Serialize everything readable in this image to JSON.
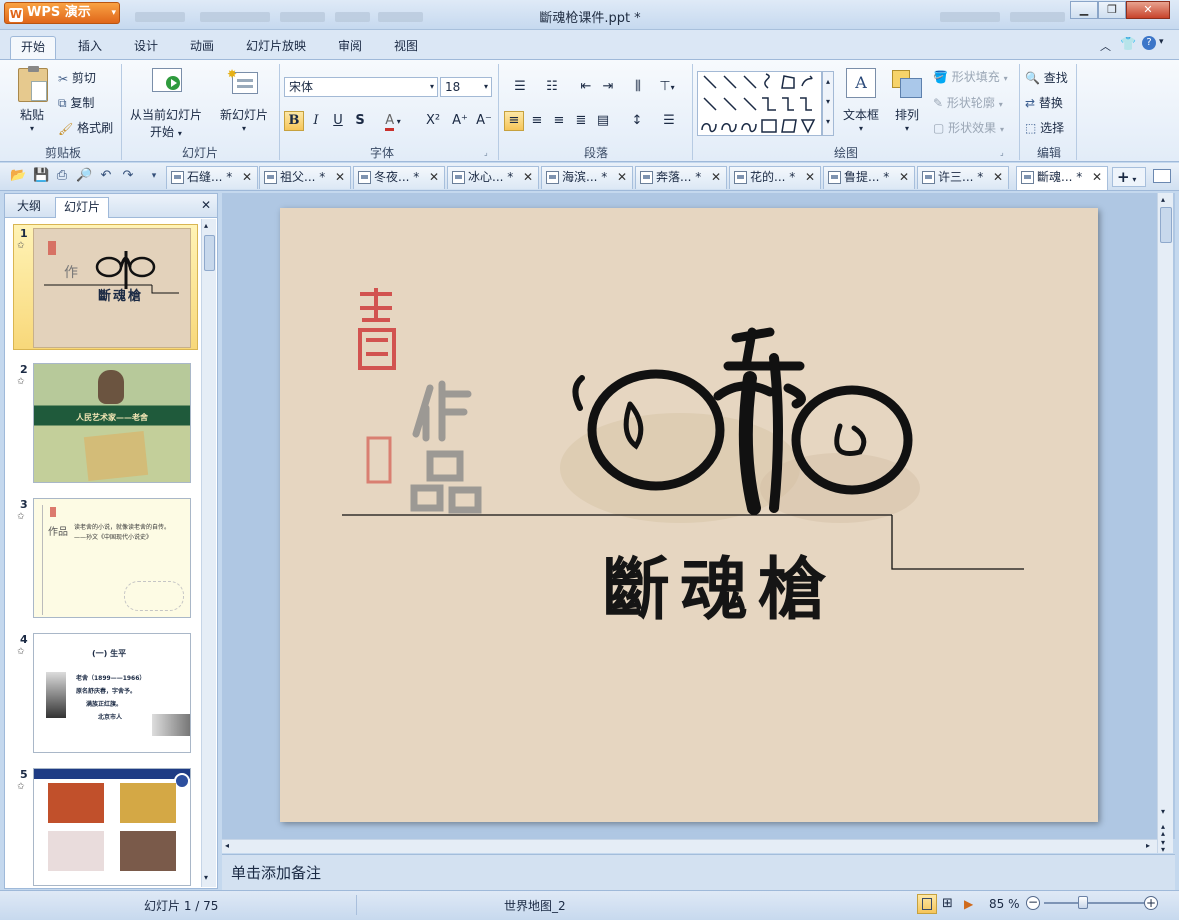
{
  "app": {
    "button_label": "WPS 演示",
    "doc_title": "斷魂枪课件.ppt *"
  },
  "menu": {
    "tabs": [
      "开始",
      "插入",
      "设计",
      "动画",
      "幻灯片放映",
      "审阅",
      "视图"
    ],
    "active": "开始"
  },
  "ribbon": {
    "clipboard": {
      "paste": "粘贴",
      "cut": "剪切",
      "copy": "复制",
      "format_painter": "格式刷",
      "group": "剪贴板"
    },
    "slides": {
      "from_current": "从当前幻灯片",
      "start": "开始",
      "new_slide": "新幻灯片",
      "group": "幻灯片"
    },
    "font": {
      "name": "宋体",
      "size": "18",
      "group": "字体",
      "bold": "B",
      "italic": "I",
      "underline": "U",
      "shadow": "S"
    },
    "paragraph": {
      "group": "段落"
    },
    "drawing": {
      "textbox": "文本框",
      "arrange": "排列",
      "fill": "形状填充",
      "outline": "形状轮廓",
      "effects": "形状效果",
      "group": "绘图"
    },
    "edit": {
      "find": "查找",
      "replace": "替换",
      "select": "选择",
      "group": "编辑"
    }
  },
  "doc_tabs": [
    "石缝... *",
    "祖父... *",
    "冬夜... *",
    "冰心... *",
    "海滨... *",
    "奔落... *",
    "花的... *",
    "鲁提... *",
    "许三... *",
    "斷魂... *"
  ],
  "left_pane": {
    "tabs": [
      "大纲",
      "幻灯片"
    ],
    "active": "幻灯片",
    "slides": [
      {
        "num": "1",
        "text": "斷魂槍"
      },
      {
        "num": "2",
        "text": "人民艺术家——老舍"
      },
      {
        "num": "3",
        "text": "读老舍的小说，就像读老舍的自传。——孙文《中国现代小说史》"
      },
      {
        "num": "4",
        "title": "(一) 生平",
        "line1": "老舍（1899——1966）",
        "line2": "原名舒庆春，字舍予。",
        "line3": "满族正红旗。",
        "line4": "北京市人"
      },
      {
        "num": "5"
      }
    ]
  },
  "slide": {
    "title": "斷魂槍"
  },
  "notes": {
    "placeholder": "单击添加备注"
  },
  "status": {
    "slide_info": "幻灯片 1 / 75",
    "template": "世界地图_2",
    "zoom": "85 %"
  },
  "colors": {
    "accent": "#e27424",
    "slide_bg": "#e6d6c1",
    "ribbon": "#dbe7f5"
  }
}
